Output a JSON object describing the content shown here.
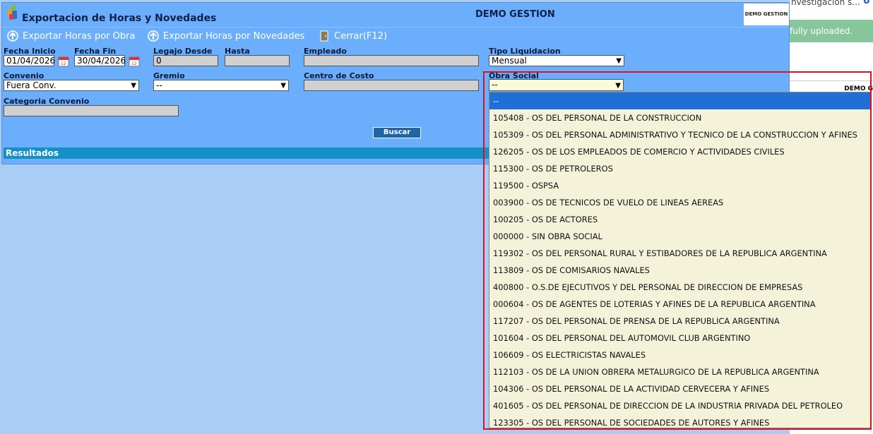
{
  "background": {
    "top_text": "nvestigación s...",
    "toast": "fully uploaded.",
    "logo_text": "DEMO G"
  },
  "window": {
    "title": "Exportacion de Horas y Novedades",
    "company": "DEMO GESTION",
    "logo_text": "DEMO GESTION"
  },
  "menu": [
    {
      "label": "Exportar Horas por Obra",
      "icon": "export-icon"
    },
    {
      "label": "Exportar Horas por Novedades",
      "icon": "export-icon"
    },
    {
      "label": "Cerrar(F12)",
      "icon": "close-door-icon"
    }
  ],
  "form": {
    "fecha_inicio": {
      "label": "Fecha Inicio",
      "value": "01/04/2026"
    },
    "fecha_fin": {
      "label": "Fecha Fin",
      "value": "30/04/2026"
    },
    "legajo_desde": {
      "label": "Legajo Desde",
      "value": "0"
    },
    "hasta": {
      "label": "Hasta",
      "value": ""
    },
    "empleado": {
      "label": "Empleado",
      "value": ""
    },
    "tipo_liquidacion": {
      "label": "Tipo Liquidacion",
      "value": "Mensual"
    },
    "convenio": {
      "label": "Convenio",
      "value": "Fuera Conv."
    },
    "gremio": {
      "label": "Gremio",
      "value": "--"
    },
    "centro_costo": {
      "label": "Centro de Costo",
      "value": ""
    },
    "obra_social": {
      "label": "Obra Social",
      "value": "--"
    },
    "categoria_convenio": {
      "label": "Categoria Convenio",
      "value": ""
    },
    "buscar_label": "Buscar"
  },
  "results_label": "Resultados",
  "obra_social_options": [
    "--",
    "105408 - OS DEL PERSONAL DE LA CONSTRUCCION",
    "105309 - OS DEL PERSONAL ADMINISTRATIVO Y TECNICO DE LA CONSTRUCCION Y AFINES",
    "126205 - OS DE LOS EMPLEADOS DE COMERCIO Y ACTIVIDADES CIVILES",
    "115300 - OS DE PETROLEROS",
    "119500 - OSPSA",
    "003900 - OS DE TECNICOS DE VUELO DE LINEAS AEREAS",
    "100205 - OS DE ACTORES",
    "000000 - SIN OBRA SOCIAL",
    "119302 - OS DEL PERSONAL RURAL Y ESTIBADORES DE LA REPUBLICA ARGENTINA",
    "113809 - OS DE COMISARIOS NAVALES",
    "400800 - O.S.DE EJECUTIVOS Y DEL PERSONAL DE DIRECCION DE EMPRESAS",
    "000604 - OS DE AGENTES DE LOTERIAS Y AFINES DE LA REPUBLICA ARGENTINA",
    "117207 - OS DEL PERSONAL DE PRENSA DE LA REPUBLICA ARGENTINA",
    "101604 - OS DEL PERSONAL DEL AUTOMOVIL CLUB ARGENTINO",
    "106609 - OS ELECTRICISTAS NAVALES",
    "112103 - OS DE LA UNION OBRERA METALURGICO DE LA REPUBLICA ARGENTINA",
    "104306 - OS DEL PERSONAL DE LA ACTIVIDAD CERVECERA Y AFINES",
    "401605 - OS DEL PERSONAL DE DIRECCION DE LA INDUSTRIA PRIVADA DEL PETROLEO",
    "123305 - OS DEL PERSONAL DE SOCIEDADES DE AUTORES Y AFINES"
  ],
  "colors": {
    "window_bg": "#6aaefc",
    "desktop_bg": "#a9cdf7",
    "selected_option": "#1f6fd6",
    "annotation_frame": "#e0101e"
  }
}
